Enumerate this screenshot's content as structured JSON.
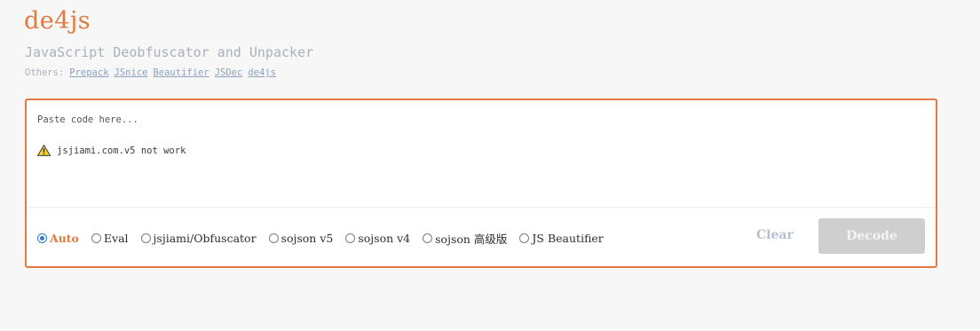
{
  "header": {
    "title": "de4js",
    "subtitle": "JavaScript Deobfuscator and Unpacker",
    "others_label": "Others:",
    "links": [
      {
        "label": "Prepack"
      },
      {
        "label": "JSnice"
      },
      {
        "label": "Beautifier"
      },
      {
        "label": "JSDec"
      },
      {
        "label": "de4js"
      }
    ]
  },
  "editor": {
    "placeholder": "Paste code here...",
    "notice_icon": "warning-icon",
    "notice_text": "jsjiami.com.v5 not work"
  },
  "options": {
    "selected": "Auto",
    "items": [
      {
        "label": "Auto"
      },
      {
        "label": "Eval"
      },
      {
        "label": "jsjiami/Obfuscator"
      },
      {
        "label": "sojson v5"
      },
      {
        "label": "sojson v4"
      },
      {
        "label": "sojson 高级版"
      },
      {
        "label": "JS Beautifier"
      }
    ]
  },
  "actions": {
    "clear_label": "Clear",
    "decode_label": "Decode"
  },
  "colors": {
    "accent": "#e27a3f",
    "muted": "#a9b1bc",
    "link": "#8ea2be",
    "radio_checked": "#2f7bd4",
    "decode_disabled_bg": "#cfcfcf"
  }
}
